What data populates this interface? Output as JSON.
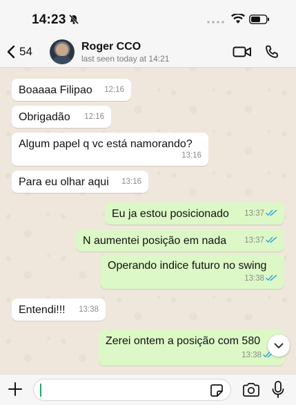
{
  "status_bar": {
    "time": "14:23"
  },
  "header": {
    "back_count": "54",
    "contact_name": "Roger CCO",
    "last_seen": "last seen today at 14:21"
  },
  "messages": [
    {
      "direction": "in",
      "text": "Boaaaa Filipao",
      "time": "12:16"
    },
    {
      "direction": "in",
      "text": "Obrigadão",
      "time": "12:16"
    },
    {
      "direction": "in",
      "text": "Algum papel q vc está namorando?",
      "time": "13:16"
    },
    {
      "direction": "in",
      "text": "Para eu olhar aqui",
      "time": "13:16"
    },
    {
      "direction": "out",
      "text": "Eu ja estou posicionado",
      "time": "13:37",
      "status": "read"
    },
    {
      "direction": "out",
      "text": "N aumentei posição em nada",
      "time": "13:37",
      "status": "read"
    },
    {
      "direction": "out",
      "text": "Operando indice futuro no swing",
      "time": "13:38",
      "status": "read"
    },
    {
      "direction": "in",
      "text": "Entendi!!!",
      "time": "13:38"
    },
    {
      "direction": "out",
      "text": "Zerei ontem a posição com 580",
      "time": "13:38",
      "status": "read"
    }
  ],
  "colors": {
    "incoming_bubble": "#ffffff",
    "outgoing_bubble": "#dcf8c6",
    "read_ticks": "#34a7e0",
    "input_caret": "#25a56a"
  },
  "icons": {
    "status": [
      "bell-slash-icon",
      "wifi-icon",
      "battery-icon"
    ],
    "header": [
      "chevron-left-icon",
      "video-call-icon",
      "phone-call-icon"
    ],
    "input": [
      "plus-icon",
      "sticker-icon",
      "camera-icon",
      "microphone-icon"
    ],
    "scroll": "chevron-down-icon"
  }
}
